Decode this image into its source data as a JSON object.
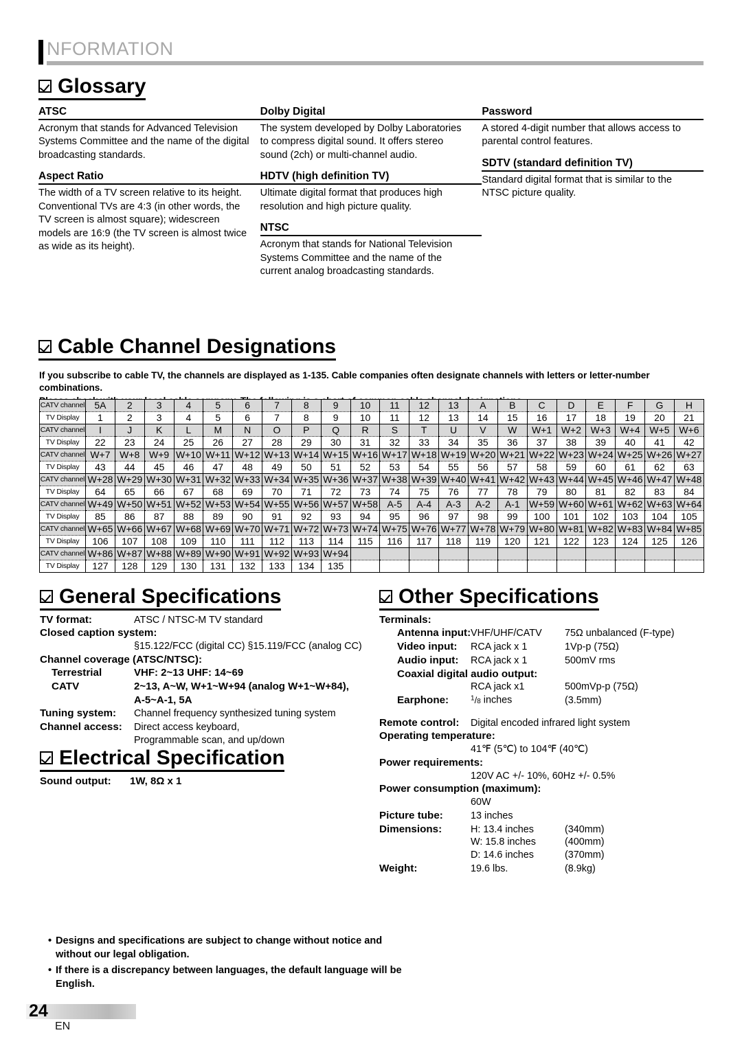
{
  "header": {
    "title": "NFORMATION"
  },
  "glossary": {
    "heading": "Glossary",
    "columns": [
      {
        "entries": [
          {
            "term": "ATSC",
            "definition": "Acronym that stands for Advanced Television Systems Committee and the name of the digital broadcasting standards."
          },
          {
            "term": "Aspect Ratio",
            "definition": "The width of a TV screen relative to its height. Conventional TVs are 4:3 (in other words, the TV screen is almost square); widescreen models are 16:9 (the TV screen is almost twice as wide as its height)."
          }
        ]
      },
      {
        "entries": [
          {
            "term": "Dolby Digital",
            "definition": "The system developed by Dolby Laboratories to compress digital sound. It offers stereo sound (2ch) or multi-channel audio."
          },
          {
            "term": "HDTV (high definition TV)",
            "definition": "Ultimate digital format that produces high resolution and high picture quality."
          },
          {
            "term": "NTSC",
            "definition": "Acronym that stands for National Television Systems Committee and the name of the current analog broadcasting standards."
          }
        ]
      },
      {
        "entries": [
          {
            "term": "Password",
            "definition": "A stored 4-digit number that allows access to parental control features."
          },
          {
            "term": "SDTV (standard definition TV)",
            "definition": "Standard digital format that is similar to the NTSC picture quality."
          }
        ]
      }
    ]
  },
  "cable": {
    "heading": "Cable Channel Designations",
    "intro_line1": "If you subscribe to cable TV, the channels are displayed as 1-135. Cable companies often designate channels with letters or letter-number combinations.",
    "intro_line2": "Please check with your local cable company. The following is a chart of common cable channel designations.",
    "row_label_catv": "CATV channel",
    "row_label_display": "TV Display",
    "rows": [
      {
        "label": "CATV channel",
        "type": "catv",
        "cells": [
          "5A",
          "2",
          "3",
          "4",
          "5",
          "6",
          "7",
          "8",
          "9",
          "10",
          "11",
          "12",
          "13",
          "A",
          "B",
          "C",
          "D",
          "E",
          "F",
          "G",
          "H"
        ]
      },
      {
        "label": "TV Display",
        "type": "display",
        "cells": [
          "1",
          "2",
          "3",
          "4",
          "5",
          "6",
          "7",
          "8",
          "9",
          "10",
          "11",
          "12",
          "13",
          "14",
          "15",
          "16",
          "17",
          "18",
          "19",
          "20",
          "21"
        ]
      },
      {
        "label": "CATV channel",
        "type": "catv",
        "cells": [
          "I",
          "J",
          "K",
          "L",
          "M",
          "N",
          "O",
          "P",
          "Q",
          "R",
          "S",
          "T",
          "U",
          "V",
          "W",
          "W+1",
          "W+2",
          "W+3",
          "W+4",
          "W+5",
          "W+6"
        ]
      },
      {
        "label": "TV Display",
        "type": "display",
        "cells": [
          "22",
          "23",
          "24",
          "25",
          "26",
          "27",
          "28",
          "29",
          "30",
          "31",
          "32",
          "33",
          "34",
          "35",
          "36",
          "37",
          "38",
          "39",
          "40",
          "41",
          "42"
        ]
      },
      {
        "label": "CATV channel",
        "type": "catv",
        "cells": [
          "W+7",
          "W+8",
          "W+9",
          "W+10",
          "W+11",
          "W+12",
          "W+13",
          "W+14",
          "W+15",
          "W+16",
          "W+17",
          "W+18",
          "W+19",
          "W+20",
          "W+21",
          "W+22",
          "W+23",
          "W+24",
          "W+25",
          "W+26",
          "W+27"
        ]
      },
      {
        "label": "TV Display",
        "type": "display",
        "cells": [
          "43",
          "44",
          "45",
          "46",
          "47",
          "48",
          "49",
          "50",
          "51",
          "52",
          "53",
          "54",
          "55",
          "56",
          "57",
          "58",
          "59",
          "60",
          "61",
          "62",
          "63"
        ]
      },
      {
        "label": "CATV channel",
        "type": "catv",
        "cells": [
          "W+28",
          "W+29",
          "W+30",
          "W+31",
          "W+32",
          "W+33",
          "W+34",
          "W+35",
          "W+36",
          "W+37",
          "W+38",
          "W+39",
          "W+40",
          "W+41",
          "W+42",
          "W+43",
          "W+44",
          "W+45",
          "W+46",
          "W+47",
          "W+48"
        ]
      },
      {
        "label": "TV Display",
        "type": "display",
        "cells": [
          "64",
          "65",
          "66",
          "67",
          "68",
          "69",
          "70",
          "71",
          "72",
          "73",
          "74",
          "75",
          "76",
          "77",
          "78",
          "79",
          "80",
          "81",
          "82",
          "83",
          "84"
        ]
      },
      {
        "label": "CATV channel",
        "type": "catv",
        "cells": [
          "W+49",
          "W+50",
          "W+51",
          "W+52",
          "W+53",
          "W+54",
          "W+55",
          "W+56",
          "W+57",
          "W+58",
          "A-5",
          "A-4",
          "A-3",
          "A-2",
          "A-1",
          "W+59",
          "W+60",
          "W+61",
          "W+62",
          "W+63",
          "W+64"
        ]
      },
      {
        "label": "TV Display",
        "type": "display",
        "cells": [
          "85",
          "86",
          "87",
          "88",
          "89",
          "90",
          "91",
          "92",
          "93",
          "94",
          "95",
          "96",
          "97",
          "98",
          "99",
          "100",
          "101",
          "102",
          "103",
          "104",
          "105"
        ]
      },
      {
        "label": "CATV channel",
        "type": "catv",
        "cells": [
          "W+65",
          "W+66",
          "W+67",
          "W+68",
          "W+69",
          "W+70",
          "W+71",
          "W+72",
          "W+73",
          "W+74",
          "W+75",
          "W+76",
          "W+77",
          "W+78",
          "W+79",
          "W+80",
          "W+81",
          "W+82",
          "W+83",
          "W+84",
          "W+85"
        ]
      },
      {
        "label": "TV Display",
        "type": "display",
        "cells": [
          "106",
          "107",
          "108",
          "109",
          "110",
          "111",
          "112",
          "113",
          "114",
          "115",
          "116",
          "117",
          "118",
          "119",
          "120",
          "121",
          "122",
          "123",
          "124",
          "125",
          "126"
        ]
      },
      {
        "label": "CATV channel",
        "type": "catv",
        "cells": [
          "W+86",
          "W+87",
          "W+88",
          "W+89",
          "W+90",
          "W+91",
          "W+92",
          "W+93",
          "W+94",
          "",
          "",
          "",
          "",
          "",
          "",
          "",
          "",
          "",
          "",
          "",
          ""
        ]
      },
      {
        "label": "TV Display",
        "type": "display",
        "cells": [
          "127",
          "128",
          "129",
          "130",
          "131",
          "132",
          "133",
          "134",
          "135",
          "",
          "",
          "",
          "",
          "",
          "",
          "",
          "",
          "",
          "",
          "",
          ""
        ]
      }
    ]
  },
  "general_specs": {
    "heading": "General Specifications",
    "tv_format_key": "TV format:",
    "tv_format_val": "ATSC / NTSC-M TV standard",
    "closed_caption_key": "Closed caption system:",
    "closed_caption_val": "§15.122/FCC (digital CC)    §15.119/FCC (analog CC)",
    "channel_coverage_key": "Channel coverage (ATSC/NTSC):",
    "terrestrial_key": "Terrestrial",
    "terrestrial_val": "VHF:  2~13   UHF:  14~69",
    "catv_key": "CATV",
    "catv_val_line1": "2~13, A~W, W+1~W+94 (analog W+1~W+84),",
    "catv_val_line2": "A-5~A-1, 5A",
    "tuning_key": "Tuning system:",
    "tuning_val": "Channel frequency synthesized tuning system",
    "access_key": "Channel access:",
    "access_val_line1": "Direct access keyboard,",
    "access_val_line2": "Programmable scan, and up/down"
  },
  "electrical_specs": {
    "heading": "Electrical Specification",
    "sound_output_key": "Sound output:",
    "sound_output_val": "1W, 8Ω x 1"
  },
  "other_specs": {
    "heading": "Other Specifications",
    "terminals_key": "Terminals:",
    "antenna_key": "Antenna input:",
    "antenna_val": "VHF/UHF/CATV",
    "antenna_note": "75Ω unbalanced (F-type)",
    "video_key": "Video input:",
    "video_val": "RCA jack x 1",
    "video_note": "1Vp-p (75Ω)",
    "audio_key": "Audio input:",
    "audio_val": "RCA jack x 1",
    "audio_note": "500mV rms",
    "coax_key": "Coaxial digital audio output:",
    "coax_val": "RCA jack x1",
    "coax_note": "500mVp-p (75Ω)",
    "earphone_key": "Earphone:",
    "earphone_val_num": "1",
    "earphone_val_den": "8",
    "earphone_val_unit": " inches",
    "earphone_note": "(3.5mm)",
    "remote_key": "Remote control:",
    "remote_val": "Digital encoded infrared light system",
    "optemp_key": "Operating temperature:",
    "optemp_val": "41℉ (5℃) to 104℉ (40℃)",
    "power_req_key": "Power requirements:",
    "power_req_val": "120V AC +/- 10%, 60Hz +/- 0.5%",
    "power_con_key": "Power consumption (maximum):",
    "power_con_val": "60W",
    "tube_key": "Picture tube:",
    "tube_val": "13 inches",
    "dim_key": "Dimensions:",
    "dim_h_val": "H:  13.4 inches",
    "dim_h_note": "(340mm)",
    "dim_w_val": "W: 15.8 inches",
    "dim_w_note": "(400mm)",
    "dim_d_val": "D:  14.6 inches",
    "dim_d_note": "(370mm)",
    "weight_key": "Weight:",
    "weight_val": "19.6 lbs.",
    "weight_note": "(8.9kg)"
  },
  "notes": {
    "bullet": "•",
    "items": [
      "Designs and specifications are subject to change without notice and without our legal obligation.",
      "If there is a discrepancy between languages, the default language will be English."
    ]
  },
  "footer": {
    "page_number": "24",
    "language": "EN"
  }
}
